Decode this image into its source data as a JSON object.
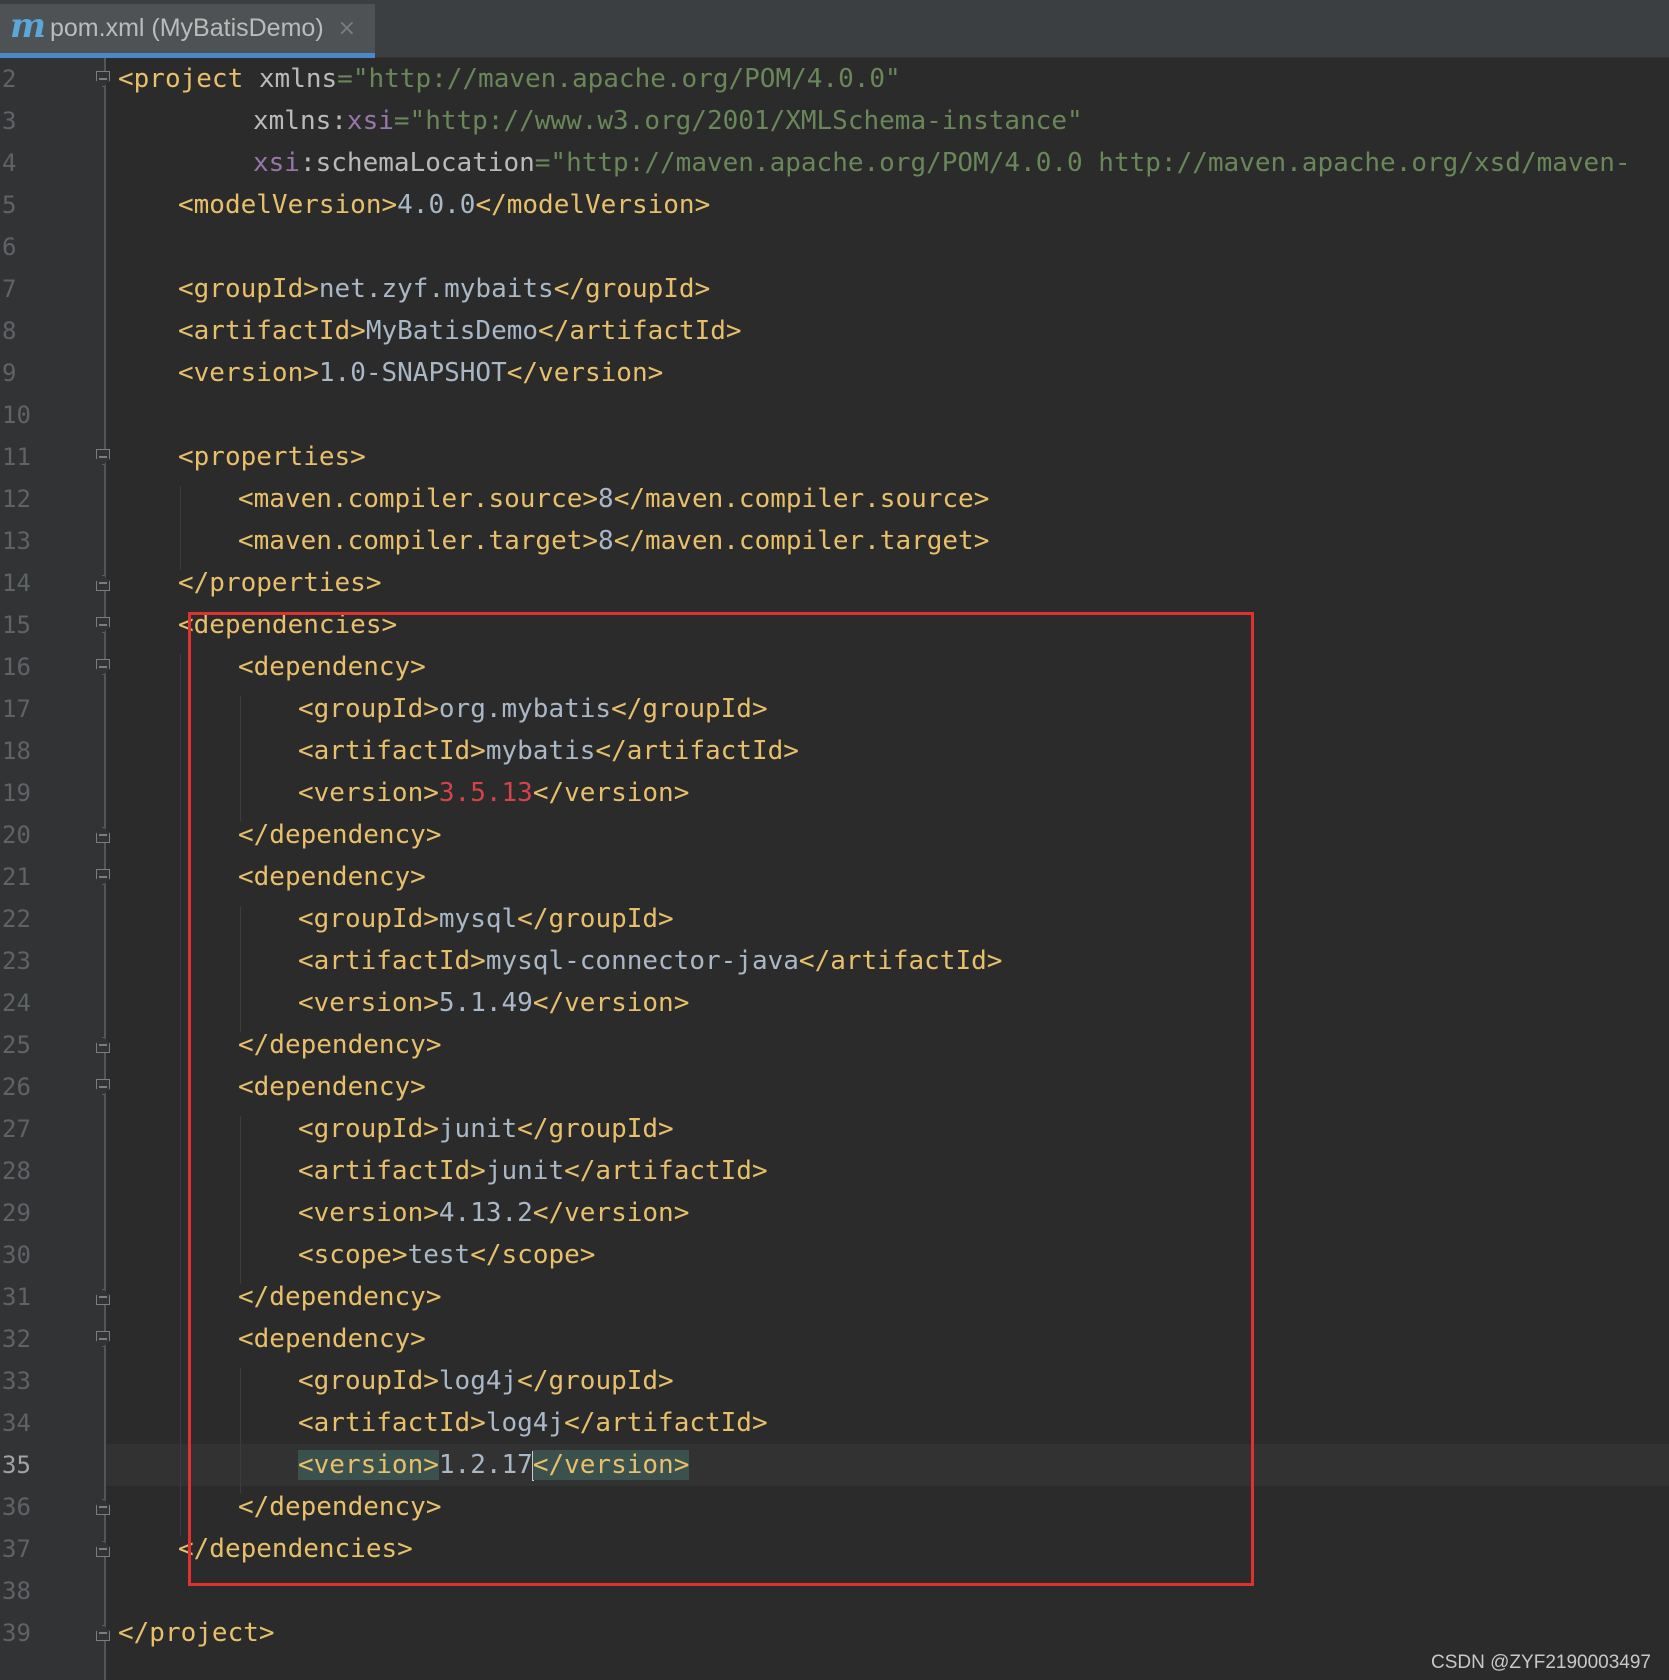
{
  "tab": {
    "icon": "m",
    "title": "pom.xml (MyBatisDemo)",
    "close": "×"
  },
  "editor": {
    "current_line": 35,
    "lines": [
      {
        "n": "2",
        "fold": "open",
        "indent": 0,
        "parts": [
          [
            "tag",
            "<project "
          ],
          [
            "attr",
            "xmlns"
          ],
          [
            "str",
            "=\"http://maven.apache.org/POM/4.0.0\""
          ]
        ]
      },
      {
        "n": "3",
        "fold": "",
        "indent": 9,
        "parts": [
          [
            "attr",
            "xmlns:"
          ],
          [
            "ns",
            "xsi"
          ],
          [
            "str",
            "=\"http://www.w3.org/2001/XMLSchema-instance\""
          ]
        ]
      },
      {
        "n": "4",
        "fold": "",
        "indent": 9,
        "parts": [
          [
            "ns",
            "xsi"
          ],
          [
            "attr",
            ":schemaLocation"
          ],
          [
            "str",
            "=\"http://maven.apache.org/POM/4.0.0 http://maven.apache.org/xsd/maven-"
          ]
        ]
      },
      {
        "n": "5",
        "fold": "",
        "indent": 4,
        "parts": [
          [
            "tag",
            "<modelVersion>"
          ],
          [
            "txt",
            "4.0.0"
          ],
          [
            "tag",
            "</modelVersion>"
          ]
        ]
      },
      {
        "n": "6",
        "fold": "",
        "indent": 0,
        "parts": []
      },
      {
        "n": "7",
        "fold": "",
        "indent": 4,
        "parts": [
          [
            "tag",
            "<groupId>"
          ],
          [
            "txt",
            "net.zyf.mybaits"
          ],
          [
            "tag",
            "</groupId>"
          ]
        ]
      },
      {
        "n": "8",
        "fold": "",
        "indent": 4,
        "parts": [
          [
            "tag",
            "<artifactId>"
          ],
          [
            "txt",
            "MyBatisDemo"
          ],
          [
            "tag",
            "</artifactId>"
          ]
        ]
      },
      {
        "n": "9",
        "fold": "",
        "indent": 4,
        "parts": [
          [
            "tag",
            "<version>"
          ],
          [
            "txt",
            "1.0-SNAPSHOT"
          ],
          [
            "tag",
            "</version>"
          ]
        ]
      },
      {
        "n": "10",
        "fold": "",
        "indent": 0,
        "parts": []
      },
      {
        "n": "11",
        "fold": "open",
        "indent": 4,
        "parts": [
          [
            "tag",
            "<properties>"
          ]
        ]
      },
      {
        "n": "12",
        "fold": "",
        "indent": 8,
        "parts": [
          [
            "tag",
            "<maven.compiler.source>"
          ],
          [
            "txt",
            "8"
          ],
          [
            "tag",
            "</maven.compiler.source>"
          ]
        ]
      },
      {
        "n": "13",
        "fold": "",
        "indent": 8,
        "parts": [
          [
            "tag",
            "<maven.compiler.target>"
          ],
          [
            "txt",
            "8"
          ],
          [
            "tag",
            "</maven.compiler.target>"
          ]
        ]
      },
      {
        "n": "14",
        "fold": "close",
        "indent": 4,
        "parts": [
          [
            "tag",
            "</properties>"
          ]
        ]
      },
      {
        "n": "15",
        "fold": "open",
        "indent": 4,
        "parts": [
          [
            "tag",
            "<dependencies>"
          ]
        ]
      },
      {
        "n": "16",
        "fold": "open",
        "indent": 8,
        "parts": [
          [
            "tag",
            "<dependency>"
          ]
        ]
      },
      {
        "n": "17",
        "fold": "",
        "indent": 12,
        "parts": [
          [
            "tag",
            "<groupId>"
          ],
          [
            "txt",
            "org.mybatis"
          ],
          [
            "tag",
            "</groupId>"
          ]
        ]
      },
      {
        "n": "18",
        "fold": "",
        "indent": 12,
        "parts": [
          [
            "tag",
            "<artifactId>"
          ],
          [
            "txt",
            "mybatis"
          ],
          [
            "tag",
            "</artifactId>"
          ]
        ]
      },
      {
        "n": "19",
        "fold": "",
        "indent": 12,
        "parts": [
          [
            "tag",
            "<version>"
          ],
          [
            "err",
            "3.5.13"
          ],
          [
            "tag",
            "</version>"
          ]
        ]
      },
      {
        "n": "20",
        "fold": "close",
        "indent": 8,
        "parts": [
          [
            "tag",
            "</dependency>"
          ]
        ]
      },
      {
        "n": "21",
        "fold": "open",
        "indent": 8,
        "parts": [
          [
            "tag",
            "<dependency>"
          ]
        ]
      },
      {
        "n": "22",
        "fold": "",
        "indent": 12,
        "parts": [
          [
            "tag",
            "<groupId>"
          ],
          [
            "txt",
            "mysql"
          ],
          [
            "tag",
            "</groupId>"
          ]
        ]
      },
      {
        "n": "23",
        "fold": "",
        "indent": 12,
        "parts": [
          [
            "tag",
            "<artifactId>"
          ],
          [
            "txt",
            "mysql-connector-java"
          ],
          [
            "tag",
            "</artifactId>"
          ]
        ]
      },
      {
        "n": "24",
        "fold": "",
        "indent": 12,
        "parts": [
          [
            "tag",
            "<version>"
          ],
          [
            "txt",
            "5.1.49"
          ],
          [
            "tag",
            "</version>"
          ]
        ]
      },
      {
        "n": "25",
        "fold": "close",
        "indent": 8,
        "parts": [
          [
            "tag",
            "</dependency>"
          ]
        ]
      },
      {
        "n": "26",
        "fold": "open",
        "indent": 8,
        "parts": [
          [
            "tag",
            "<dependency>"
          ]
        ]
      },
      {
        "n": "27",
        "fold": "",
        "indent": 12,
        "parts": [
          [
            "tag",
            "<groupId>"
          ],
          [
            "txt",
            "junit"
          ],
          [
            "tag",
            "</groupId>"
          ]
        ]
      },
      {
        "n": "28",
        "fold": "",
        "indent": 12,
        "parts": [
          [
            "tag",
            "<artifactId>"
          ],
          [
            "txt",
            "junit"
          ],
          [
            "tag",
            "</artifactId>"
          ]
        ]
      },
      {
        "n": "29",
        "fold": "",
        "indent": 12,
        "parts": [
          [
            "tag",
            "<version>"
          ],
          [
            "txt",
            "4.13.2"
          ],
          [
            "tag",
            "</version>"
          ]
        ]
      },
      {
        "n": "30",
        "fold": "",
        "indent": 12,
        "parts": [
          [
            "tag",
            "<scope>"
          ],
          [
            "txt",
            "test"
          ],
          [
            "tag",
            "</scope>"
          ]
        ]
      },
      {
        "n": "31",
        "fold": "close",
        "indent": 8,
        "parts": [
          [
            "tag",
            "</dependency>"
          ]
        ]
      },
      {
        "n": "32",
        "fold": "open",
        "indent": 8,
        "parts": [
          [
            "tag",
            "<dependency>"
          ]
        ]
      },
      {
        "n": "33",
        "fold": "",
        "indent": 12,
        "parts": [
          [
            "tag",
            "<groupId>"
          ],
          [
            "txt",
            "log4j"
          ],
          [
            "tag",
            "</groupId>"
          ]
        ]
      },
      {
        "n": "34",
        "fold": "",
        "indent": 12,
        "parts": [
          [
            "tag",
            "<artifactId>"
          ],
          [
            "txt",
            "log4j"
          ],
          [
            "tag",
            "</artifactId>"
          ]
        ]
      },
      {
        "n": "35",
        "fold": "",
        "indent": 12,
        "parts": [
          [
            "tag hl",
            "<version>"
          ],
          [
            "txt",
            "1.2.17"
          ],
          [
            "cursor",
            ""
          ],
          [
            "tag hl",
            "</version>"
          ]
        ]
      },
      {
        "n": "36",
        "fold": "close",
        "indent": 8,
        "parts": [
          [
            "tag",
            "</dependency>"
          ]
        ]
      },
      {
        "n": "37",
        "fold": "close",
        "indent": 4,
        "parts": [
          [
            "tag",
            "</dependencies>"
          ]
        ]
      },
      {
        "n": "38",
        "fold": "",
        "indent": 0,
        "parts": []
      },
      {
        "n": "39",
        "fold": "close",
        "indent": 0,
        "parts": [
          [
            "tag",
            "</project>"
          ]
        ]
      }
    ]
  },
  "annotation": {
    "box_color": "#e03131"
  },
  "watermark": "CSDN @ZYF2190003497"
}
